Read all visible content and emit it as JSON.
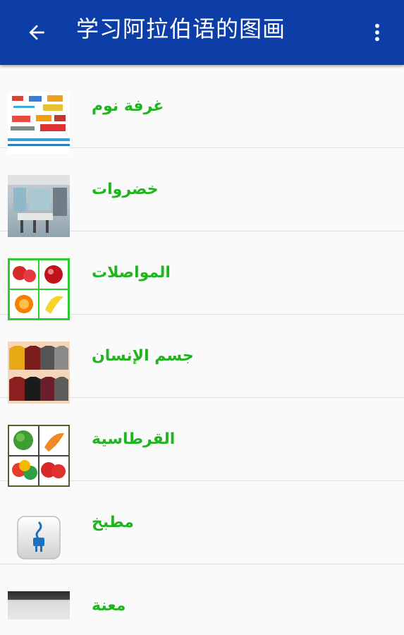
{
  "appbar": {
    "title": "学习阿拉伯语的图画",
    "back_icon": "arrow-left-icon",
    "menu_icon": "more-vert-icon",
    "color": "#0d3ea8"
  },
  "list": {
    "label_color": "#20b520",
    "items": [
      {
        "label": "غرفة نوم",
        "thumb": "vehicles-image"
      },
      {
        "label": "خضروات",
        "thumb": "kitchen-image"
      },
      {
        "label": "المواصلات",
        "thumb": "fruits-image"
      },
      {
        "label": "جسم الإنسان",
        "thumb": "tshirts-image"
      },
      {
        "label": "القرطاسية",
        "thumb": "vegetables-image"
      },
      {
        "label": "مطبخ",
        "thumb": "power-plug-image"
      },
      {
        "label": "معنة",
        "thumb": "room-image"
      }
    ]
  }
}
